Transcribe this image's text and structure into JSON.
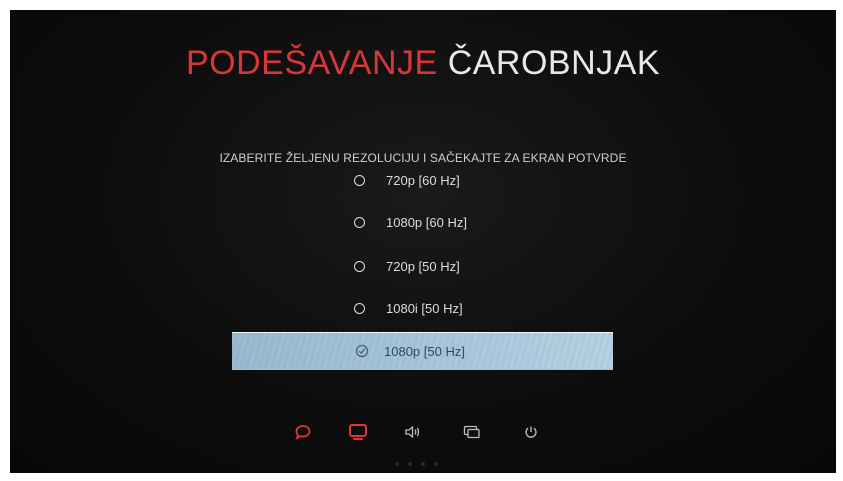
{
  "header": {
    "title_part1": "PODEŠAVANJE",
    "title_part2": "ČAROBNJAK"
  },
  "instruction": "IZABERITE ŽELJENU REZOLUCIJU I SAČEKAJTE ZA EKRAN POTVRDE",
  "resolutions": [
    {
      "label": "720p [60 Hz]",
      "selected": false
    },
    {
      "label": "1080p [60 Hz]",
      "selected": false
    },
    {
      "label": "720p [50 Hz]",
      "selected": false
    },
    {
      "label": "1080i [50 Hz]",
      "selected": false
    },
    {
      "label": "1080p [50 Hz]",
      "selected": true
    }
  ],
  "steps": [
    {
      "icon": "chat-bubble-icon",
      "active": true
    },
    {
      "icon": "tv-screen-icon",
      "active": true
    },
    {
      "icon": "speaker-icon",
      "active": false
    },
    {
      "icon": "multi-screen-icon",
      "active": false
    },
    {
      "icon": "power-icon",
      "active": false
    }
  ],
  "colors": {
    "accent_red": "#d8363b",
    "title_white": "#e8e8e8",
    "selected_bg": "#cfe1ec",
    "selected_text": "#2f4a5a",
    "inactive_icon": "#bdbdbd"
  }
}
